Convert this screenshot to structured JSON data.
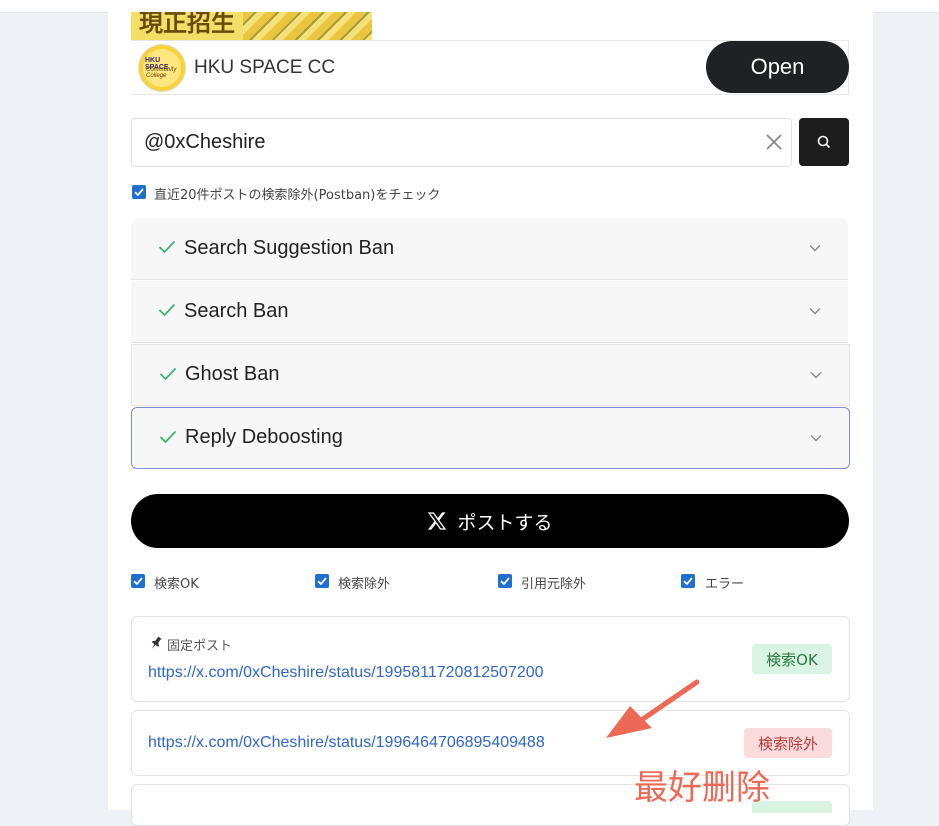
{
  "ad": {
    "banner_text": "現正招生",
    "brand_short": "HKU SPACE",
    "brand_sub": "Community College",
    "name": "HKU SPACE CC",
    "open_label": "Open"
  },
  "search": {
    "value": "@0xCheshire",
    "postban_label": "直近20件ポストの検索除外(Postban)をチェック"
  },
  "accordions": [
    {
      "label": "Search Suggestion Ban"
    },
    {
      "label": "Search Ban"
    },
    {
      "label": "Ghost Ban"
    },
    {
      "label": "Reply Deboosting"
    }
  ],
  "post_button": "ポストする",
  "filters": [
    {
      "label": "検索OK"
    },
    {
      "label": "検索除外"
    },
    {
      "label": "引用元除外"
    },
    {
      "label": "エラー"
    }
  ],
  "posts": [
    {
      "pinned_label": "固定ポスト",
      "url": "https://x.com/0xCheshire/status/1995811720812507200",
      "status": "検索OK"
    },
    {
      "url": "https://x.com/0xCheshire/status/1996464706895409488",
      "status": "検索除外"
    }
  ],
  "annotation": "最好删除",
  "colors": {
    "accent_blue": "#1f6fd1",
    "check_green": "#3cb371",
    "ok_bg": "#d9f4e2",
    "ng_bg": "#fbdcdc",
    "annotation": "#ec6a55"
  }
}
